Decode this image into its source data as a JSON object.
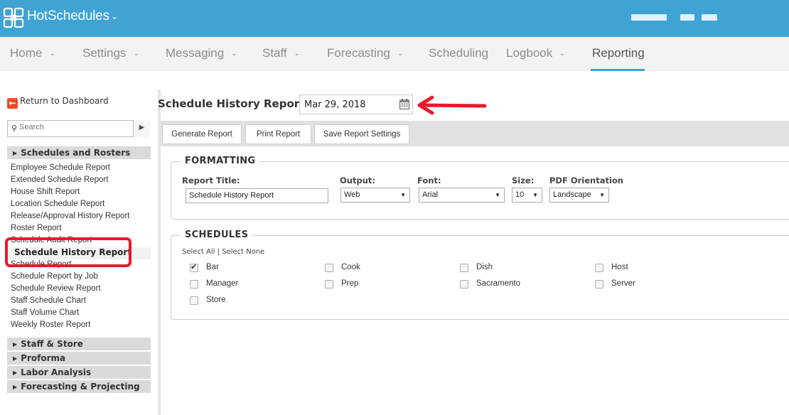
{
  "app": {
    "name": "HotSchedules"
  },
  "nav": {
    "items": [
      {
        "label": "Home",
        "chevron": true
      },
      {
        "label": "Settings",
        "chevron": true
      },
      {
        "label": "Messaging",
        "chevron": true
      },
      {
        "label": "Staff",
        "chevron": true
      },
      {
        "label": "Forecasting",
        "chevron": true
      },
      {
        "label": "Scheduling",
        "chevron": false
      },
      {
        "label": "Logbook",
        "chevron": true
      },
      {
        "label": "Reporting",
        "chevron": false,
        "active": true
      }
    ]
  },
  "sidebar": {
    "return_label": "Return to Dashboard",
    "search_placeholder": "Search",
    "sections": [
      {
        "label": "Schedules and Rosters"
      },
      {
        "label": "Staff & Store"
      },
      {
        "label": "Proforma"
      },
      {
        "label": "Labor Analysis"
      },
      {
        "label": "Forecasting & Projecting"
      }
    ],
    "items": [
      "Employee Schedule Report",
      "Extended Schedule Report",
      "House Shift Report",
      "Location Schedule Report",
      "Release/Approval History Report",
      "Roster Report",
      "Schedule Audit Report",
      "Schedule History Report",
      "Schedule Report",
      "Schedule Report by Job",
      "Schedule Review Report",
      "Staff Schedule Chart",
      "Staff Volume Chart",
      "Weekly Roster Report"
    ],
    "active_item": "Schedule History Report"
  },
  "main": {
    "title": "Schedule History Report",
    "date": "Mar 29, 2018",
    "buttons": {
      "generate": "Generate Report",
      "print": "Print Report",
      "save": "Save Report Settings"
    },
    "formatting": {
      "heading": "FORMATTING",
      "report_title_label": "Report Title:",
      "report_title_value": "Schedule History Report",
      "output_label": "Output:",
      "output_value": "Web",
      "font_label": "Font:",
      "font_value": "Arial",
      "size_label": "Size:",
      "size_value": "10",
      "orientation_label": "PDF Orientation",
      "orientation_value": "Landscape"
    },
    "schedules": {
      "heading": "SCHEDULES",
      "select_all": "Select All",
      "separator": "|",
      "select_none": "Select None",
      "options": [
        {
          "label": "Bar",
          "checked": true
        },
        {
          "label": "Cook",
          "checked": false
        },
        {
          "label": "Dish",
          "checked": false
        },
        {
          "label": "Host",
          "checked": false
        },
        {
          "label": "Manager",
          "checked": false
        },
        {
          "label": "Prep",
          "checked": false
        },
        {
          "label": "Sacramento",
          "checked": false
        },
        {
          "label": "Server",
          "checked": false
        },
        {
          "label": "Store",
          "checked": false
        }
      ]
    }
  },
  "colors": {
    "brand": "#3fa3d4",
    "highlight": "#e8192c",
    "return_icon": "#e8502c"
  }
}
